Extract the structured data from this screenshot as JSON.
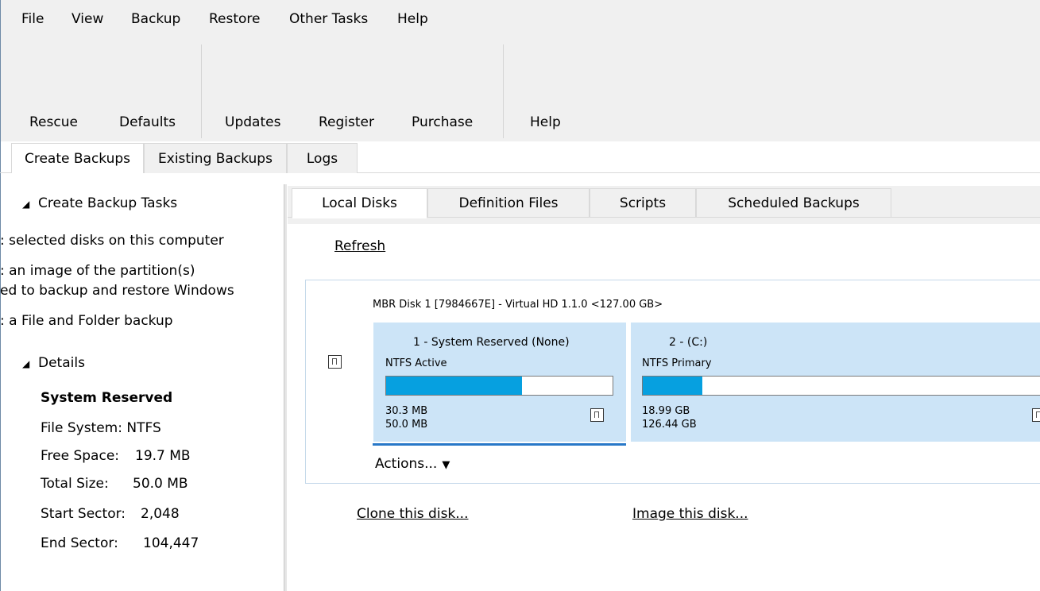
{
  "menu": {
    "file": "File",
    "view": "View",
    "backup": "Backup",
    "restore": "Restore",
    "other_tasks": "Other Tasks",
    "help": "Help"
  },
  "ribbon": {
    "rescue": "Rescue",
    "defaults": "Defaults",
    "updates": "Updates",
    "register": "Register",
    "purchase": "Purchase",
    "help": "Help"
  },
  "main_tabs": [
    {
      "label": "Create Backups",
      "active": true
    },
    {
      "label": "Existing Backups",
      "active": false
    },
    {
      "label": "Logs",
      "active": false
    }
  ],
  "left_pane": {
    "tasks_heading": "Create Backup Tasks",
    "tasks": [
      ": selected disks on this computer",
      ": an image of the partition(s)",
      "ed to backup and restore Windows",
      ": a File and Folder backup"
    ],
    "details_heading": "Details",
    "details": {
      "title": "System Reserved",
      "file_system": "File System: NTFS",
      "free_space_label": "Free Space:",
      "free_space_value": "19.7 MB",
      "total_size_label": "Total Size:",
      "total_size_value": "50.0 MB",
      "start_sector_label": "Start Sector:",
      "start_sector_value": "2,048",
      "end_sector_label": "End Sector:",
      "end_sector_value": "104,447"
    }
  },
  "sub_tabs": [
    {
      "label": "Local Disks",
      "active": true
    },
    {
      "label": "Definition Files",
      "active": false
    },
    {
      "label": "Scripts",
      "active": false
    },
    {
      "label": "Scheduled Backups",
      "active": false
    }
  ],
  "content": {
    "refresh": "Refresh",
    "disk": {
      "header": "MBR Disk 1 [7984667E] - Virtual HD 1.1.0  <127.00 GB>",
      "partitions": [
        {
          "title": "1 - System Reserved (None)",
          "fs": "NTFS Active",
          "used_fraction": 0.6,
          "used": "30.3 MB",
          "total": "50.0 MB"
        },
        {
          "title": "2 -  (C:)",
          "fs": "NTFS Primary",
          "used_fraction": 0.15,
          "used": "18.99 GB",
          "total": "126.44 GB"
        }
      ],
      "actions": "Actions...",
      "actions_caret_icon": "caret-down-icon"
    },
    "clone_link": "Clone this disk...",
    "image_link": "Image this disk..."
  },
  "colors": {
    "partition_bg": "#cce4f7",
    "usage_fill": "#06a0e0",
    "selection": "#2878c8"
  }
}
